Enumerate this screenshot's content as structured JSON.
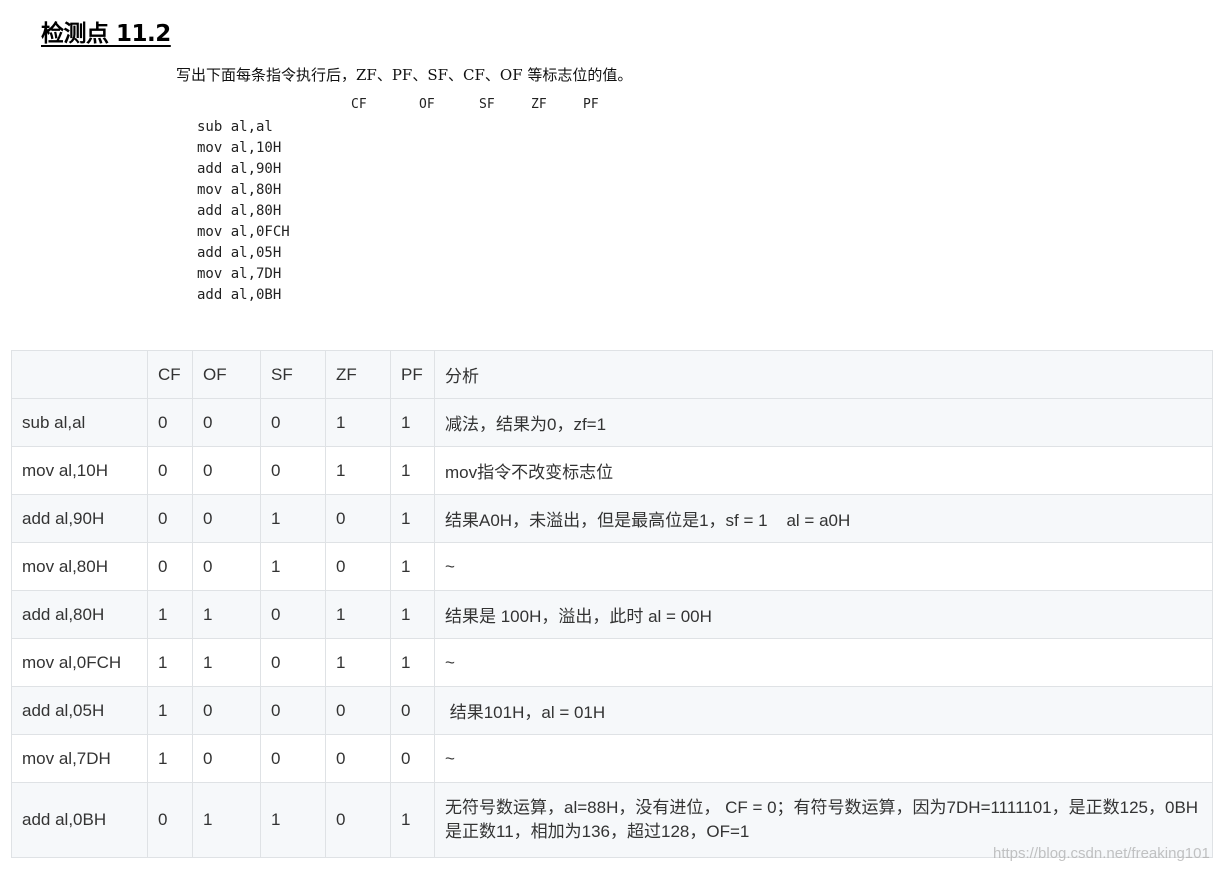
{
  "heading": "检测点 11.2",
  "problem_text": "写出下面每条指令执行后，ZF、PF、SF、CF、OF 等标志位的值。",
  "figure_flags": [
    "CF",
    "OF",
    "SF",
    "ZF",
    "PF"
  ],
  "figure_code": [
    "sub al,al",
    "mov al,10H",
    "add al,90H",
    "mov al,80H",
    "add al,80H",
    "mov al,0FCH",
    "add al,05H",
    "mov al,7DH",
    "add al,0BH"
  ],
  "table": {
    "headers": [
      "",
      "CF",
      "OF",
      "SF",
      "ZF",
      "PF",
      "分析"
    ],
    "rows": [
      {
        "instr": "sub al,al",
        "cf": "0",
        "of": "0",
        "sf": "0",
        "zf": "1",
        "pf": "1",
        "note": "减法，结果为0，zf=1"
      },
      {
        "instr": "mov al,10H",
        "cf": "0",
        "of": "0",
        "sf": "0",
        "zf": "1",
        "pf": "1",
        "note": "mov指令不改变标志位"
      },
      {
        "instr": "add al,90H",
        "cf": "0",
        "of": "0",
        "sf": "1",
        "zf": "0",
        "pf": "1",
        "note": "结果A0H，未溢出，但是最高位是1，sf = 1    al = a0H"
      },
      {
        "instr": "mov al,80H",
        "cf": "0",
        "of": "0",
        "sf": "1",
        "zf": "0",
        "pf": "1",
        "note": "~"
      },
      {
        "instr": "add al,80H",
        "cf": "1",
        "of": "1",
        "sf": "0",
        "zf": "1",
        "pf": "1",
        "note": "结果是 100H，溢出，此时 al = 00H"
      },
      {
        "instr": "mov al,0FCH",
        "cf": "1",
        "of": "1",
        "sf": "0",
        "zf": "1",
        "pf": "1",
        "note": "~"
      },
      {
        "instr": "add al,05H",
        "cf": "1",
        "of": "0",
        "sf": "0",
        "zf": "0",
        "pf": "0",
        "note": " 结果101H，al = 01H"
      },
      {
        "instr": "mov al,7DH",
        "cf": "1",
        "of": "0",
        "sf": "0",
        "zf": "0",
        "pf": "0",
        "note": "~"
      },
      {
        "instr": "add al,0BH",
        "cf": "0",
        "of": "1",
        "sf": "1",
        "zf": "0",
        "pf": "1",
        "note": "无符号数运算，al=88H，没有进位， CF = 0；有符号数运算，因为7DH=1111101，是正数125，0BH是正数11，相加为136，超过128，OF=1"
      }
    ]
  },
  "watermark": "https://blog.csdn.net/freaking101"
}
